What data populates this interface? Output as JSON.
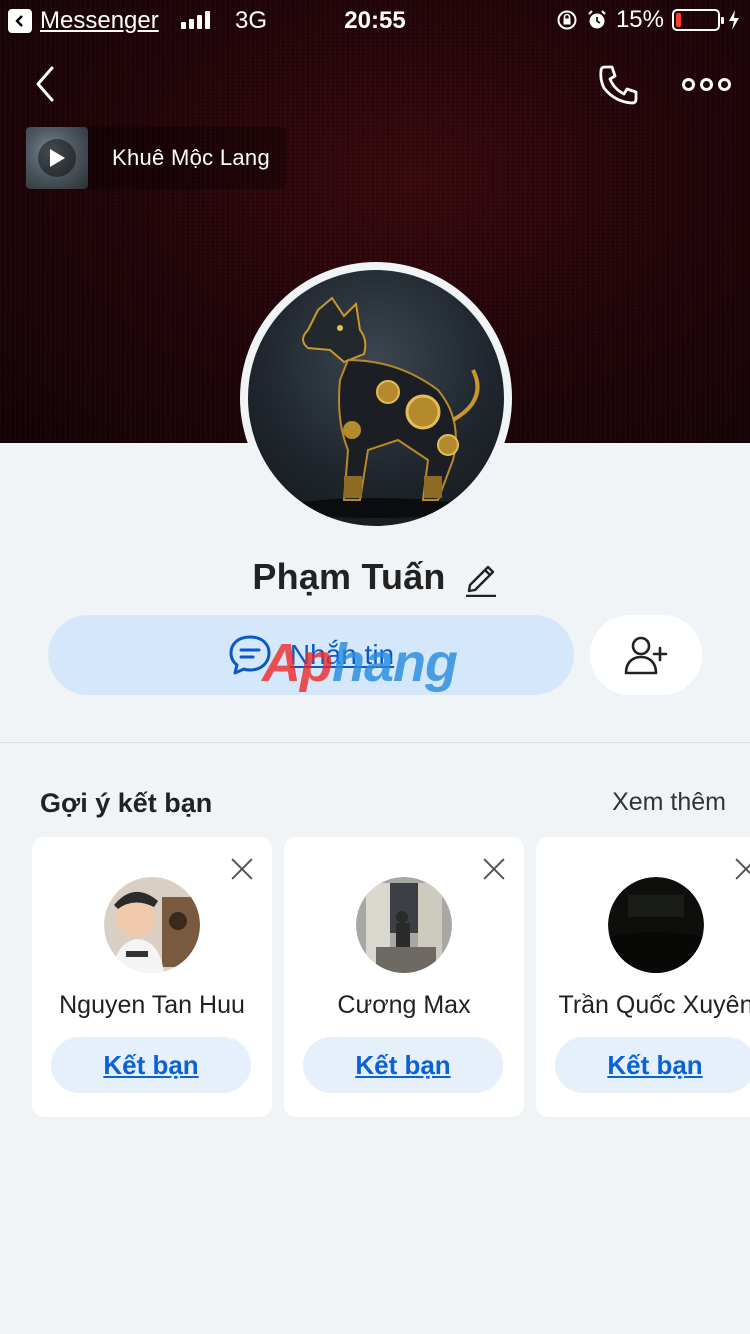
{
  "status_bar": {
    "back_app": "Messenger",
    "network": "3G",
    "time": "20:55",
    "battery": "15%",
    "battery_level": 0.15
  },
  "header": {
    "back_icon": "chevron-left-icon",
    "call_icon": "phone-icon",
    "more_icon": "more-dots-icon"
  },
  "music": {
    "title": "Khuê Mộc Lang",
    "icon": "play-icon"
  },
  "profile": {
    "name": "Phạm Tuấn",
    "edit_icon": "pencil-icon",
    "message_label": "Nhắn tin",
    "message_icon": "chat-bubble-icon",
    "add_friend_icon": "add-user-icon"
  },
  "watermark": {
    "part_a": "Ap",
    "part_b": "hang"
  },
  "suggestions": {
    "title": "Gợi ý kết bạn",
    "see_more": "Xem thêm",
    "items": [
      {
        "name": "Nguyen Tan Huu",
        "action": "Kết bạn"
      },
      {
        "name": "Cương Max",
        "action": "Kết bạn"
      },
      {
        "name": "Trần Quốc Xuyên",
        "action": "Kết bạn"
      }
    ]
  },
  "colors": {
    "accent": "#0a62d6",
    "message_button_bg": "#d5e8fb",
    "cover_bg": "#240509",
    "battery_low": "#ff3b30"
  }
}
